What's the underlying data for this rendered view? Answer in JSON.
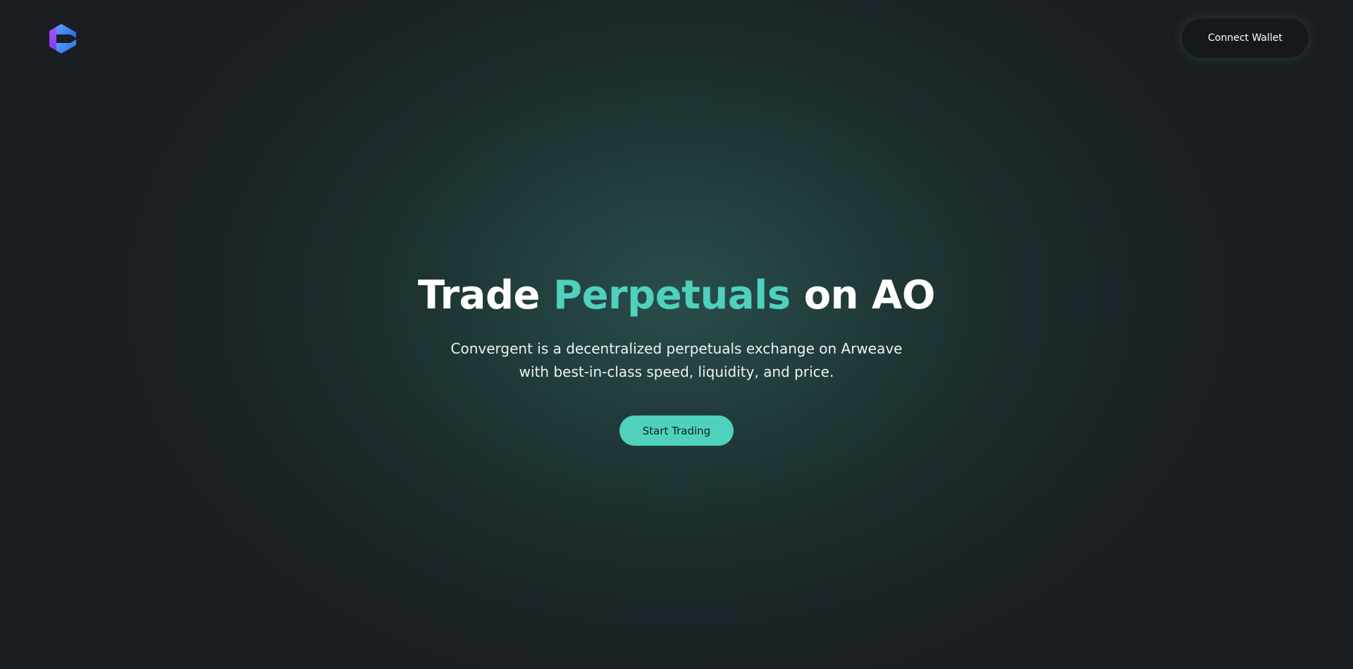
{
  "header": {
    "logo_icon": "convergent-logo-icon",
    "connect_wallet_label": "Connect Wallet"
  },
  "hero": {
    "title_prefix": "Trade ",
    "title_highlight": "Perpetuals",
    "title_suffix": " on AO",
    "subtitle_line1": "Convergent is a decentralized perpetuals exchange on Arweave",
    "subtitle_line2": "with best-in-class speed, liquidity, and price.",
    "cta_label": "Start Trading"
  },
  "colors": {
    "accent": "#4fd1bd",
    "background": "#1a1d21",
    "button_dark": "#16191c",
    "logo_purple": "#9b5cf6",
    "logo_blue": "#3b82f6"
  }
}
